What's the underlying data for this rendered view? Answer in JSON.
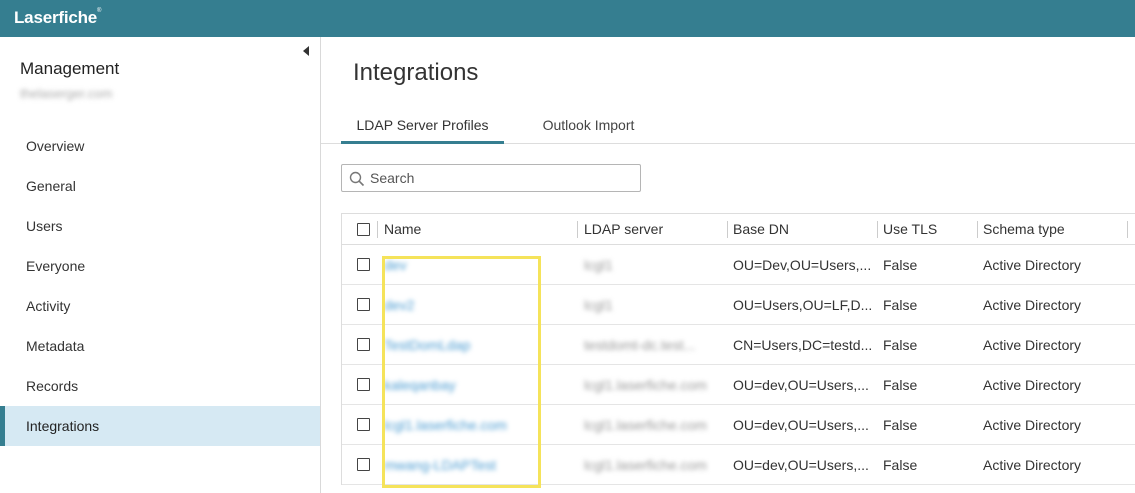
{
  "app": {
    "logo": "Laserfiche",
    "logo_mark": "®"
  },
  "sidebar": {
    "title": "Management",
    "subtitle": "thelaserger.com",
    "items": [
      {
        "label": "Overview"
      },
      {
        "label": "General"
      },
      {
        "label": "Users"
      },
      {
        "label": "Everyone"
      },
      {
        "label": "Activity"
      },
      {
        "label": "Metadata"
      },
      {
        "label": "Records"
      },
      {
        "label": "Integrations",
        "active": true
      }
    ]
  },
  "main": {
    "title": "Integrations",
    "tabs": [
      {
        "label": "LDAP Server Profiles",
        "active": true
      },
      {
        "label": "Outlook Import"
      }
    ],
    "search": {
      "placeholder": "Search",
      "value": ""
    },
    "table": {
      "headers": [
        "Name",
        "LDAP server",
        "Base DN",
        "Use TLS",
        "Schema type"
      ],
      "rows": [
        {
          "name": "dev",
          "ldap_server": "lcgl1",
          "base_dn": "OU=Dev,OU=Users,...",
          "use_tls": "False",
          "schema_type": "Active Directory"
        },
        {
          "name": "dev2",
          "ldap_server": "lcgl1",
          "base_dn": "OU=Users,OU=LF,D...",
          "use_tls": "False",
          "schema_type": "Active Directory"
        },
        {
          "name": "TestDomLdap",
          "ldap_server": "testdomt-dc.test...",
          "base_dn": "CN=Users,DC=testd...",
          "use_tls": "False",
          "schema_type": "Active Directory"
        },
        {
          "name": "kaleqanbay",
          "ldap_server": "lcgl1.laserfiche.com",
          "base_dn": "OU=dev,OU=Users,...",
          "use_tls": "False",
          "schema_type": "Active Directory"
        },
        {
          "name": "lcgl1.laserfiche.com",
          "ldap_server": "lcgl1.laserfiche.com",
          "base_dn": "OU=dev,OU=Users,...",
          "use_tls": "False",
          "schema_type": "Active Directory"
        },
        {
          "name": "mwang-LDAPTest",
          "ldap_server": "lcgl1.laserfiche.com",
          "base_dn": "OU=dev,OU=Users,...",
          "use_tls": "False",
          "schema_type": "Active Directory"
        }
      ]
    }
  },
  "colors": {
    "header_bg": "#357e90",
    "active_nav_bg": "#d6e9f3",
    "link": "#4a9bd1",
    "highlight_box": "#f5e35a"
  }
}
